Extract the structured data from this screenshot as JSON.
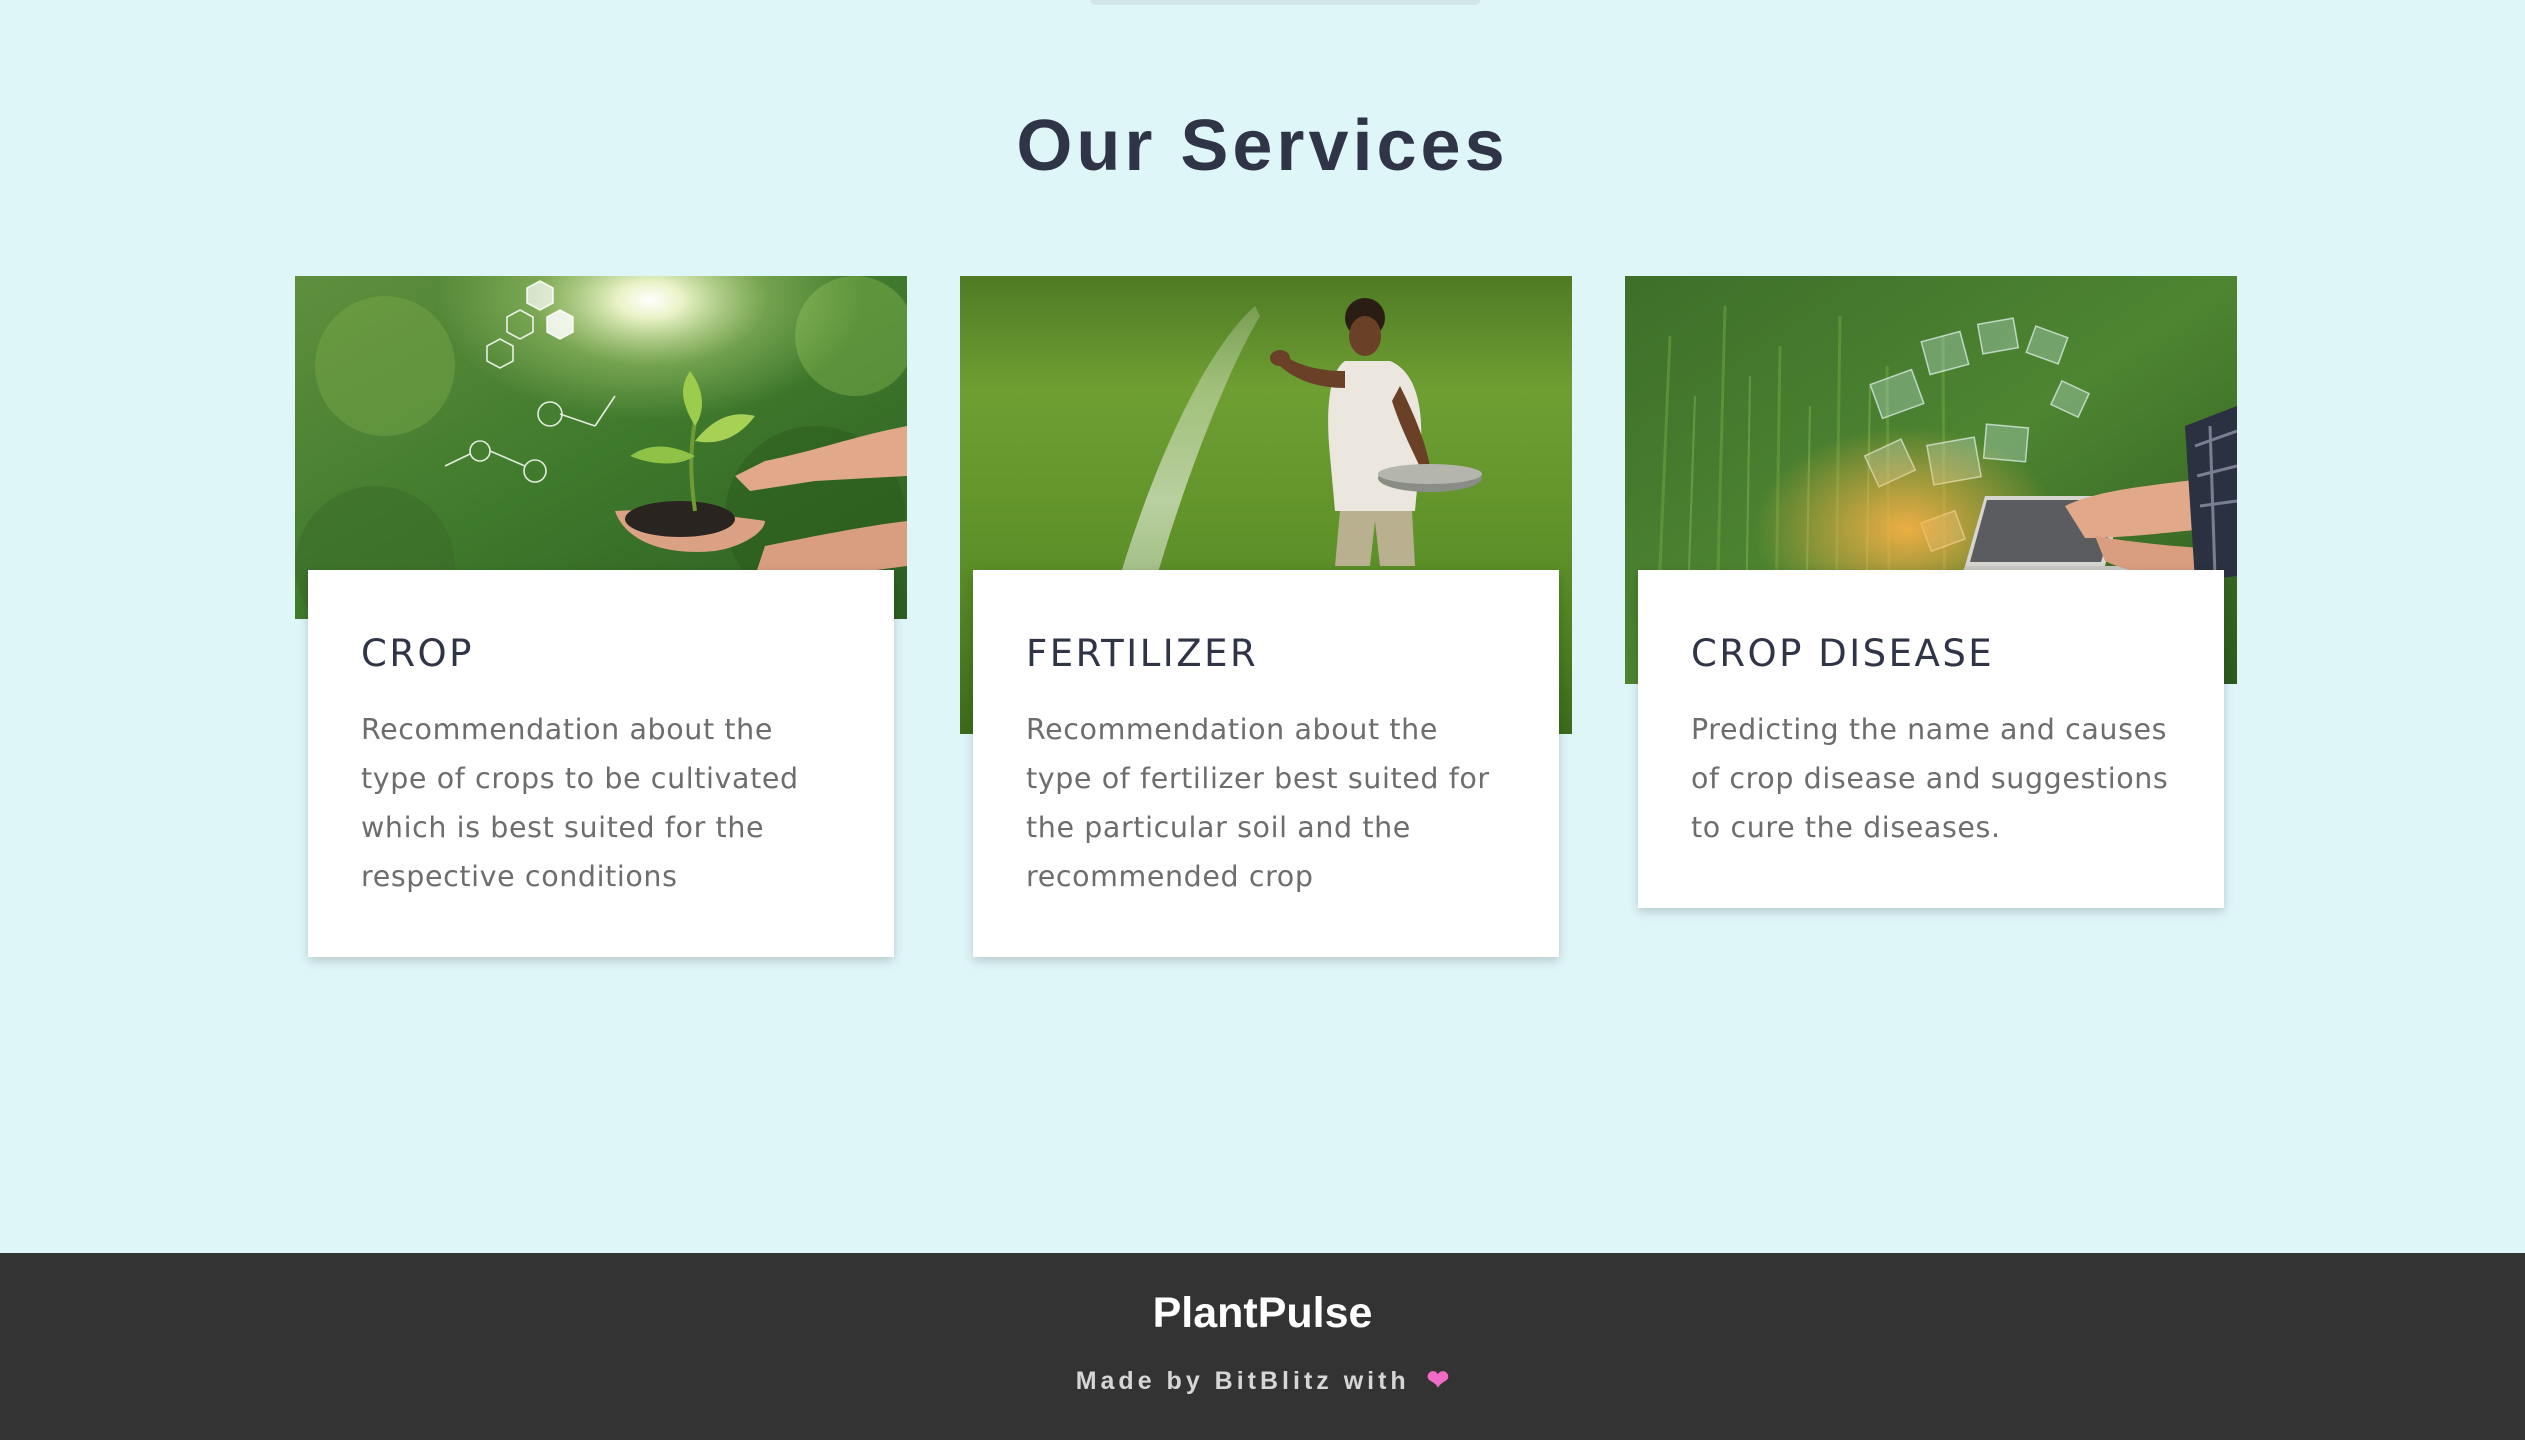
{
  "services": {
    "title": "Our Services",
    "cards": [
      {
        "title": "CROP",
        "description": "Recommendation about the type of crops to be cultivated which is best suited for the respective conditions",
        "image": "hands-holding-seedling-in-soil"
      },
      {
        "title": "FERTILIZER",
        "description": "Recommendation about the type of fertilizer best suited for the particular soil and the recommended crop",
        "image": "farmer-spreading-fertilizer-in-field"
      },
      {
        "title": "CROP DISEASE",
        "description": "Predicting the name and causes of crop disease and suggestions to cure the diseases.",
        "image": "farmer-with-laptop-in-wheat-field"
      }
    ]
  },
  "footer": {
    "brand": "PlantPulse",
    "credit": "Made by BitBlitz with",
    "heart_icon": "pink-heart-icon"
  },
  "colors": {
    "background": "#dff6f9",
    "footer_background": "#333333",
    "heading": "#2f3447",
    "body_text": "#6d6d6d",
    "heart": "#f06bc4"
  }
}
